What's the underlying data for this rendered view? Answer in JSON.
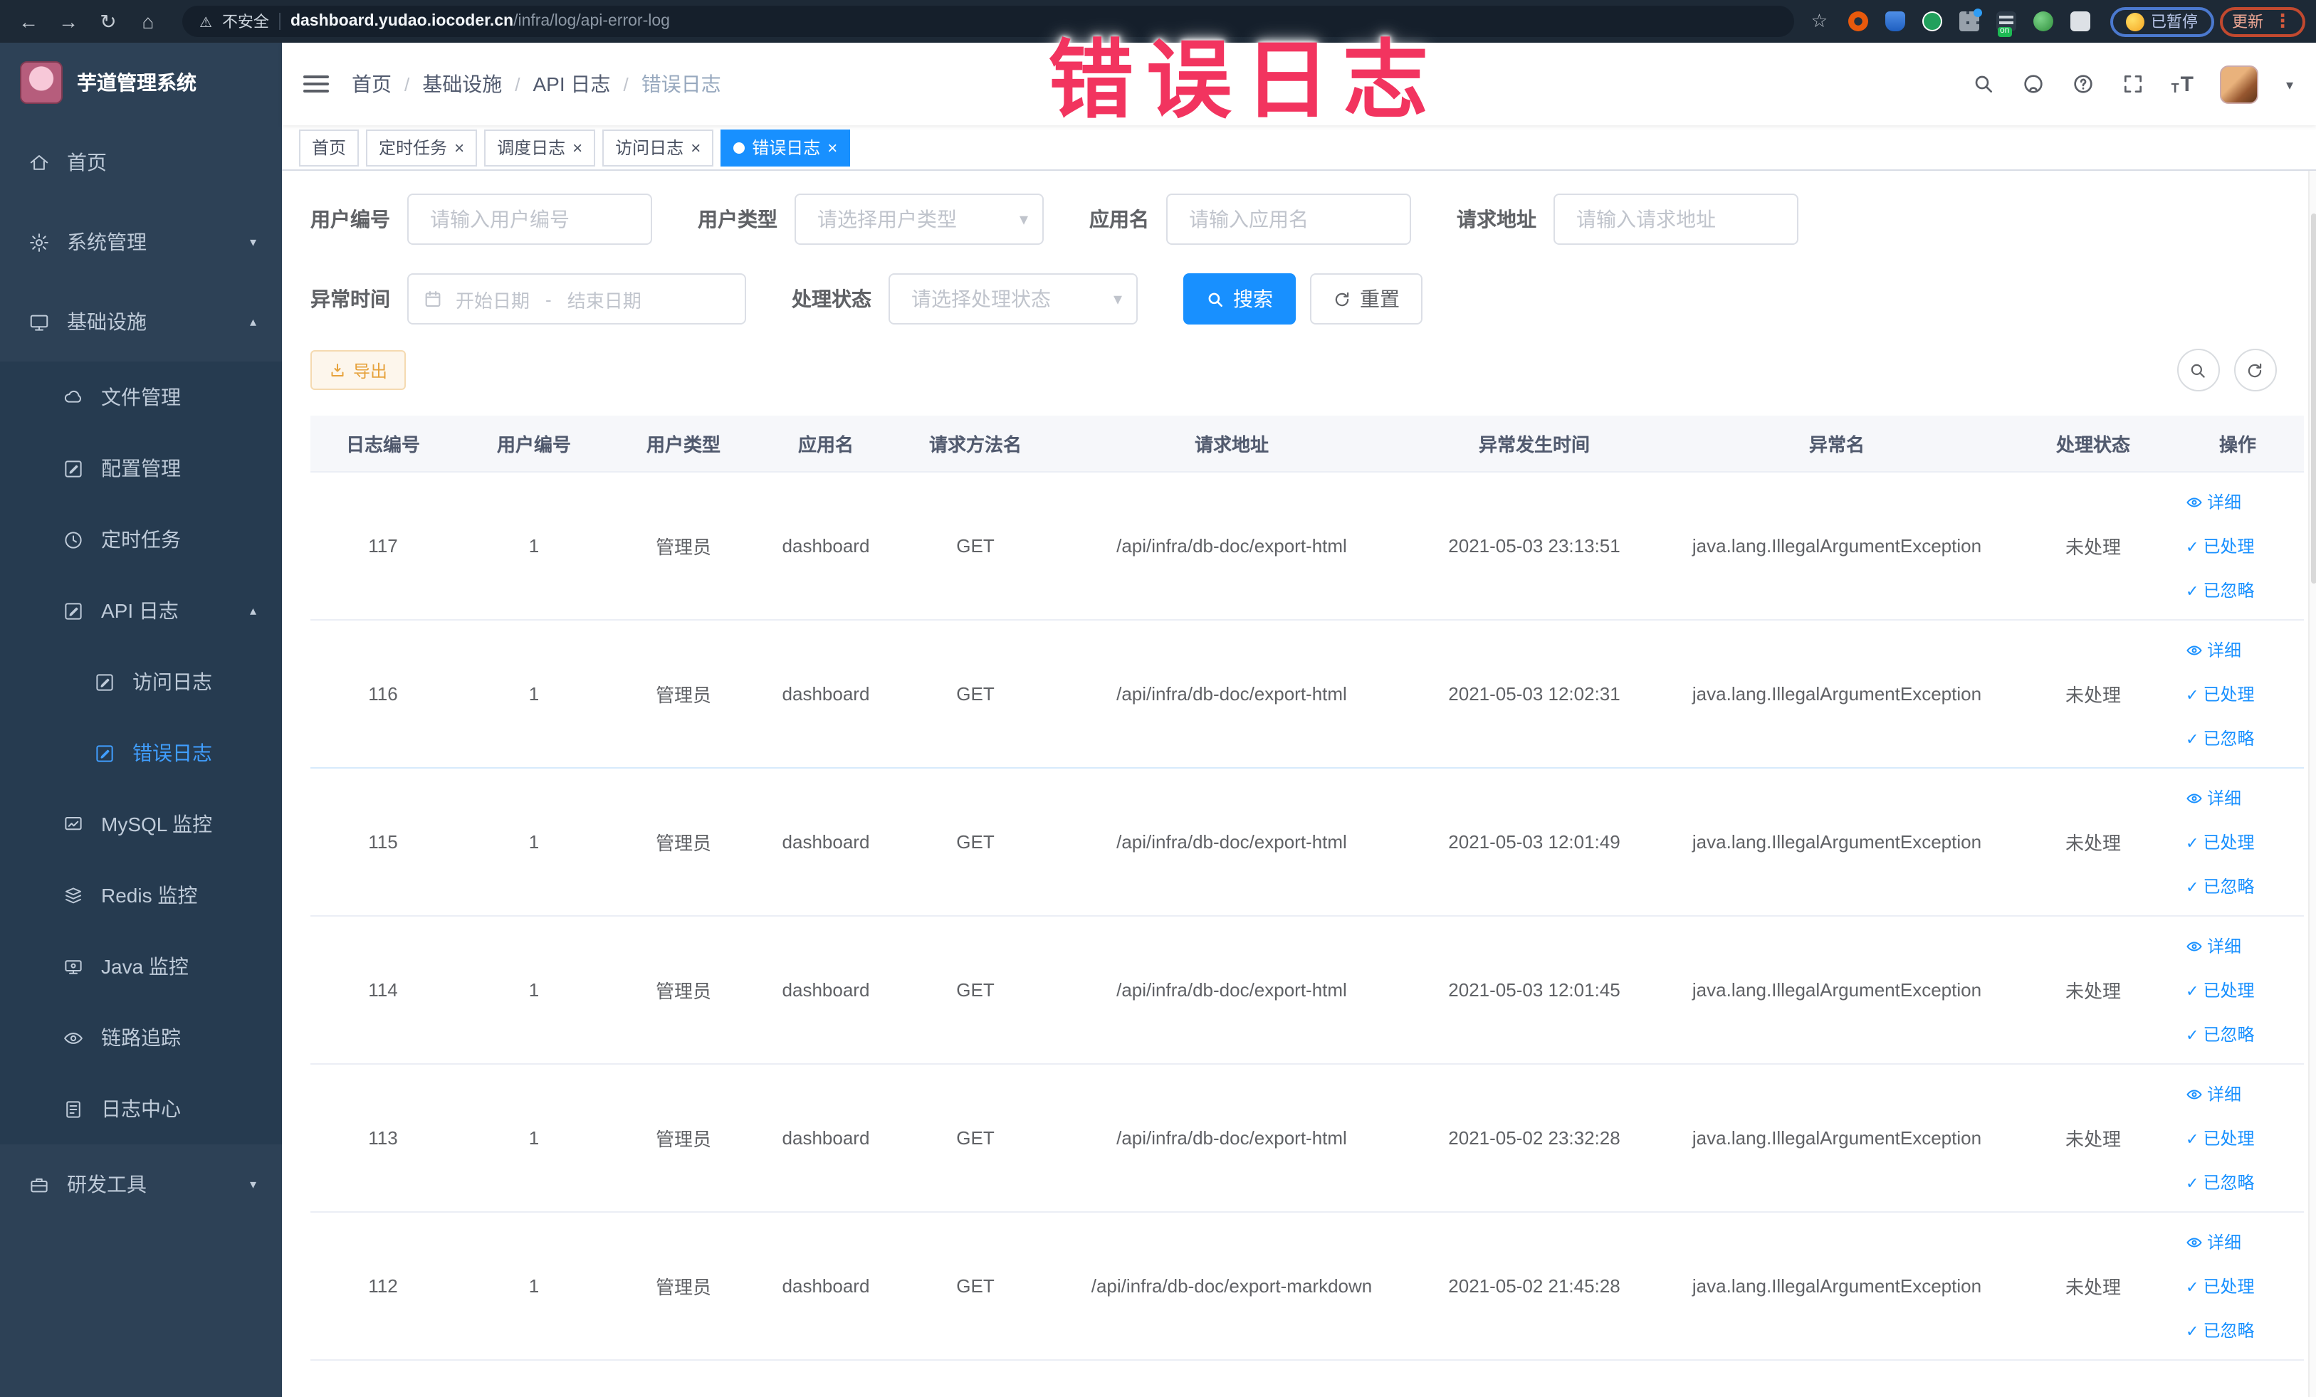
{
  "browser": {
    "security_label": "不安全",
    "url_domain": "dashboard.yudao.iocoder.cn",
    "url_path": "/infra/log/api-error-log",
    "paused_badge": "已暂停",
    "update_badge": "更新",
    "extension_on_badge": "on"
  },
  "annotation": {
    "text": "错误日志"
  },
  "sidebar": {
    "title": "芋道管理系统",
    "menu": [
      {
        "label": "首页"
      },
      {
        "label": "系统管理"
      },
      {
        "label": "基础设施"
      },
      {
        "label": "文件管理"
      },
      {
        "label": "配置管理"
      },
      {
        "label": "定时任务"
      },
      {
        "label": "API 日志"
      },
      {
        "label": "访问日志"
      },
      {
        "label": "错误日志"
      },
      {
        "label": "MySQL 监控"
      },
      {
        "label": "Redis 监控"
      },
      {
        "label": "Java 监控"
      },
      {
        "label": "链路追踪"
      },
      {
        "label": "日志中心"
      },
      {
        "label": "研发工具"
      }
    ]
  },
  "header": {
    "breadcrumb": [
      "首页",
      "基础设施",
      "API 日志",
      "错误日志"
    ]
  },
  "tabs": [
    {
      "label": "首页"
    },
    {
      "label": "定时任务"
    },
    {
      "label": "调度日志"
    },
    {
      "label": "访问日志"
    },
    {
      "label": "错误日志"
    }
  ],
  "filters": {
    "user_id_label": "用户编号",
    "user_id_placeholder": "请输入用户编号",
    "user_type_label": "用户类型",
    "user_type_placeholder": "请选择用户类型",
    "app_name_label": "应用名",
    "app_name_placeholder": "请输入应用名",
    "request_url_label": "请求地址",
    "request_url_placeholder": "请输入请求地址",
    "exception_time_label": "异常时间",
    "date_start_placeholder": "开始日期",
    "date_separator": "-",
    "date_end_placeholder": "结束日期",
    "process_status_label": "处理状态",
    "process_status_placeholder": "请选择处理状态",
    "search_button": "搜索",
    "reset_button": "重置"
  },
  "toolbar": {
    "export_button": "导出"
  },
  "table": {
    "columns": [
      "日志编号",
      "用户编号",
      "用户类型",
      "应用名",
      "请求方法名",
      "请求地址",
      "异常发生时间",
      "异常名",
      "处理状态",
      "操作"
    ],
    "actions": {
      "detail": "详细",
      "processed": "已处理",
      "ignored": "已忽略"
    },
    "rows": [
      {
        "id": "117",
        "user_id": "1",
        "user_type": "管理员",
        "app": "dashboard",
        "method": "GET",
        "url": "/api/infra/db-doc/export-html",
        "time": "2021-05-03 23:13:51",
        "exception": "java.lang.IllegalArgumentException",
        "status": "未处理"
      },
      {
        "id": "116",
        "user_id": "1",
        "user_type": "管理员",
        "app": "dashboard",
        "method": "GET",
        "url": "/api/infra/db-doc/export-html",
        "time": "2021-05-03 12:02:31",
        "exception": "java.lang.IllegalArgumentException",
        "status": "未处理"
      },
      {
        "id": "115",
        "user_id": "1",
        "user_type": "管理员",
        "app": "dashboard",
        "method": "GET",
        "url": "/api/infra/db-doc/export-html",
        "time": "2021-05-03 12:01:49",
        "exception": "java.lang.IllegalArgumentException",
        "status": "未处理"
      },
      {
        "id": "114",
        "user_id": "1",
        "user_type": "管理员",
        "app": "dashboard",
        "method": "GET",
        "url": "/api/infra/db-doc/export-html",
        "time": "2021-05-03 12:01:45",
        "exception": "java.lang.IllegalArgumentException",
        "status": "未处理"
      },
      {
        "id": "113",
        "user_id": "1",
        "user_type": "管理员",
        "app": "dashboard",
        "method": "GET",
        "url": "/api/infra/db-doc/export-html",
        "time": "2021-05-02 23:32:28",
        "exception": "java.lang.IllegalArgumentException",
        "status": "未处理"
      },
      {
        "id": "112",
        "user_id": "1",
        "user_type": "管理员",
        "app": "dashboard",
        "method": "GET",
        "url": "/api/infra/db-doc/export-markdown",
        "time": "2021-05-02 21:45:28",
        "exception": "java.lang.IllegalArgumentException",
        "status": "未处理"
      }
    ]
  },
  "colors": {
    "primary": "#1890ff",
    "sidebar_bg": "#2d4156",
    "submenu_bg": "#263b50",
    "menu_active": "#409eff",
    "export_accent": "#e6a23c",
    "annotation": "#f2345f"
  }
}
